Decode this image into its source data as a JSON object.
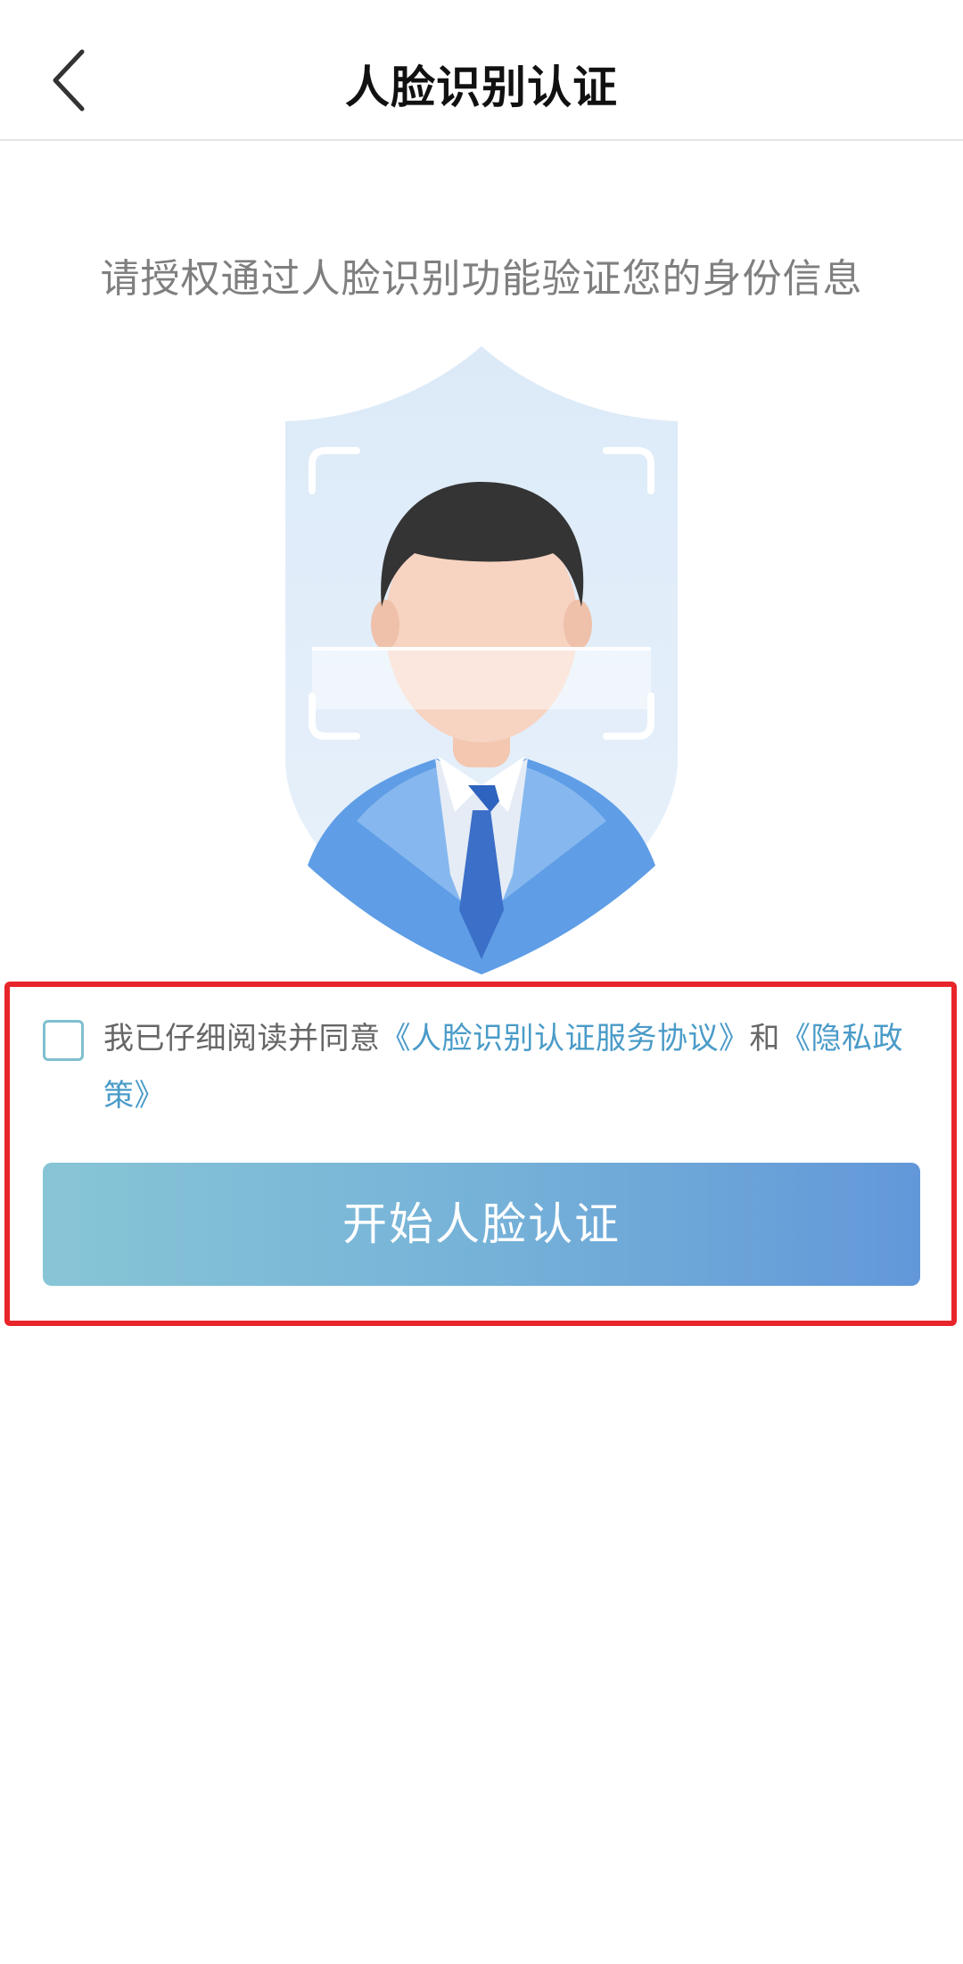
{
  "header": {
    "title": "人脸识别认证",
    "back_icon": "chevron-left-icon"
  },
  "main": {
    "subtitle": "请授权通过人脸识别功能验证您的身份信息",
    "illustration_icon": "face-scan-shield-icon"
  },
  "consent": {
    "checked": false,
    "prefix": "我已仔细阅读并同意",
    "service_agreement": "《人脸识别认证服务协议》",
    "conjunction": "和",
    "privacy_policy": "《隐私政策》"
  },
  "actions": {
    "start_label": "开始人脸认证"
  },
  "colors": {
    "link": "#4a9bc8",
    "button_gradient_start": "#87c5d6",
    "button_gradient_end": "#6298d9",
    "highlight_border": "#e8252a"
  }
}
